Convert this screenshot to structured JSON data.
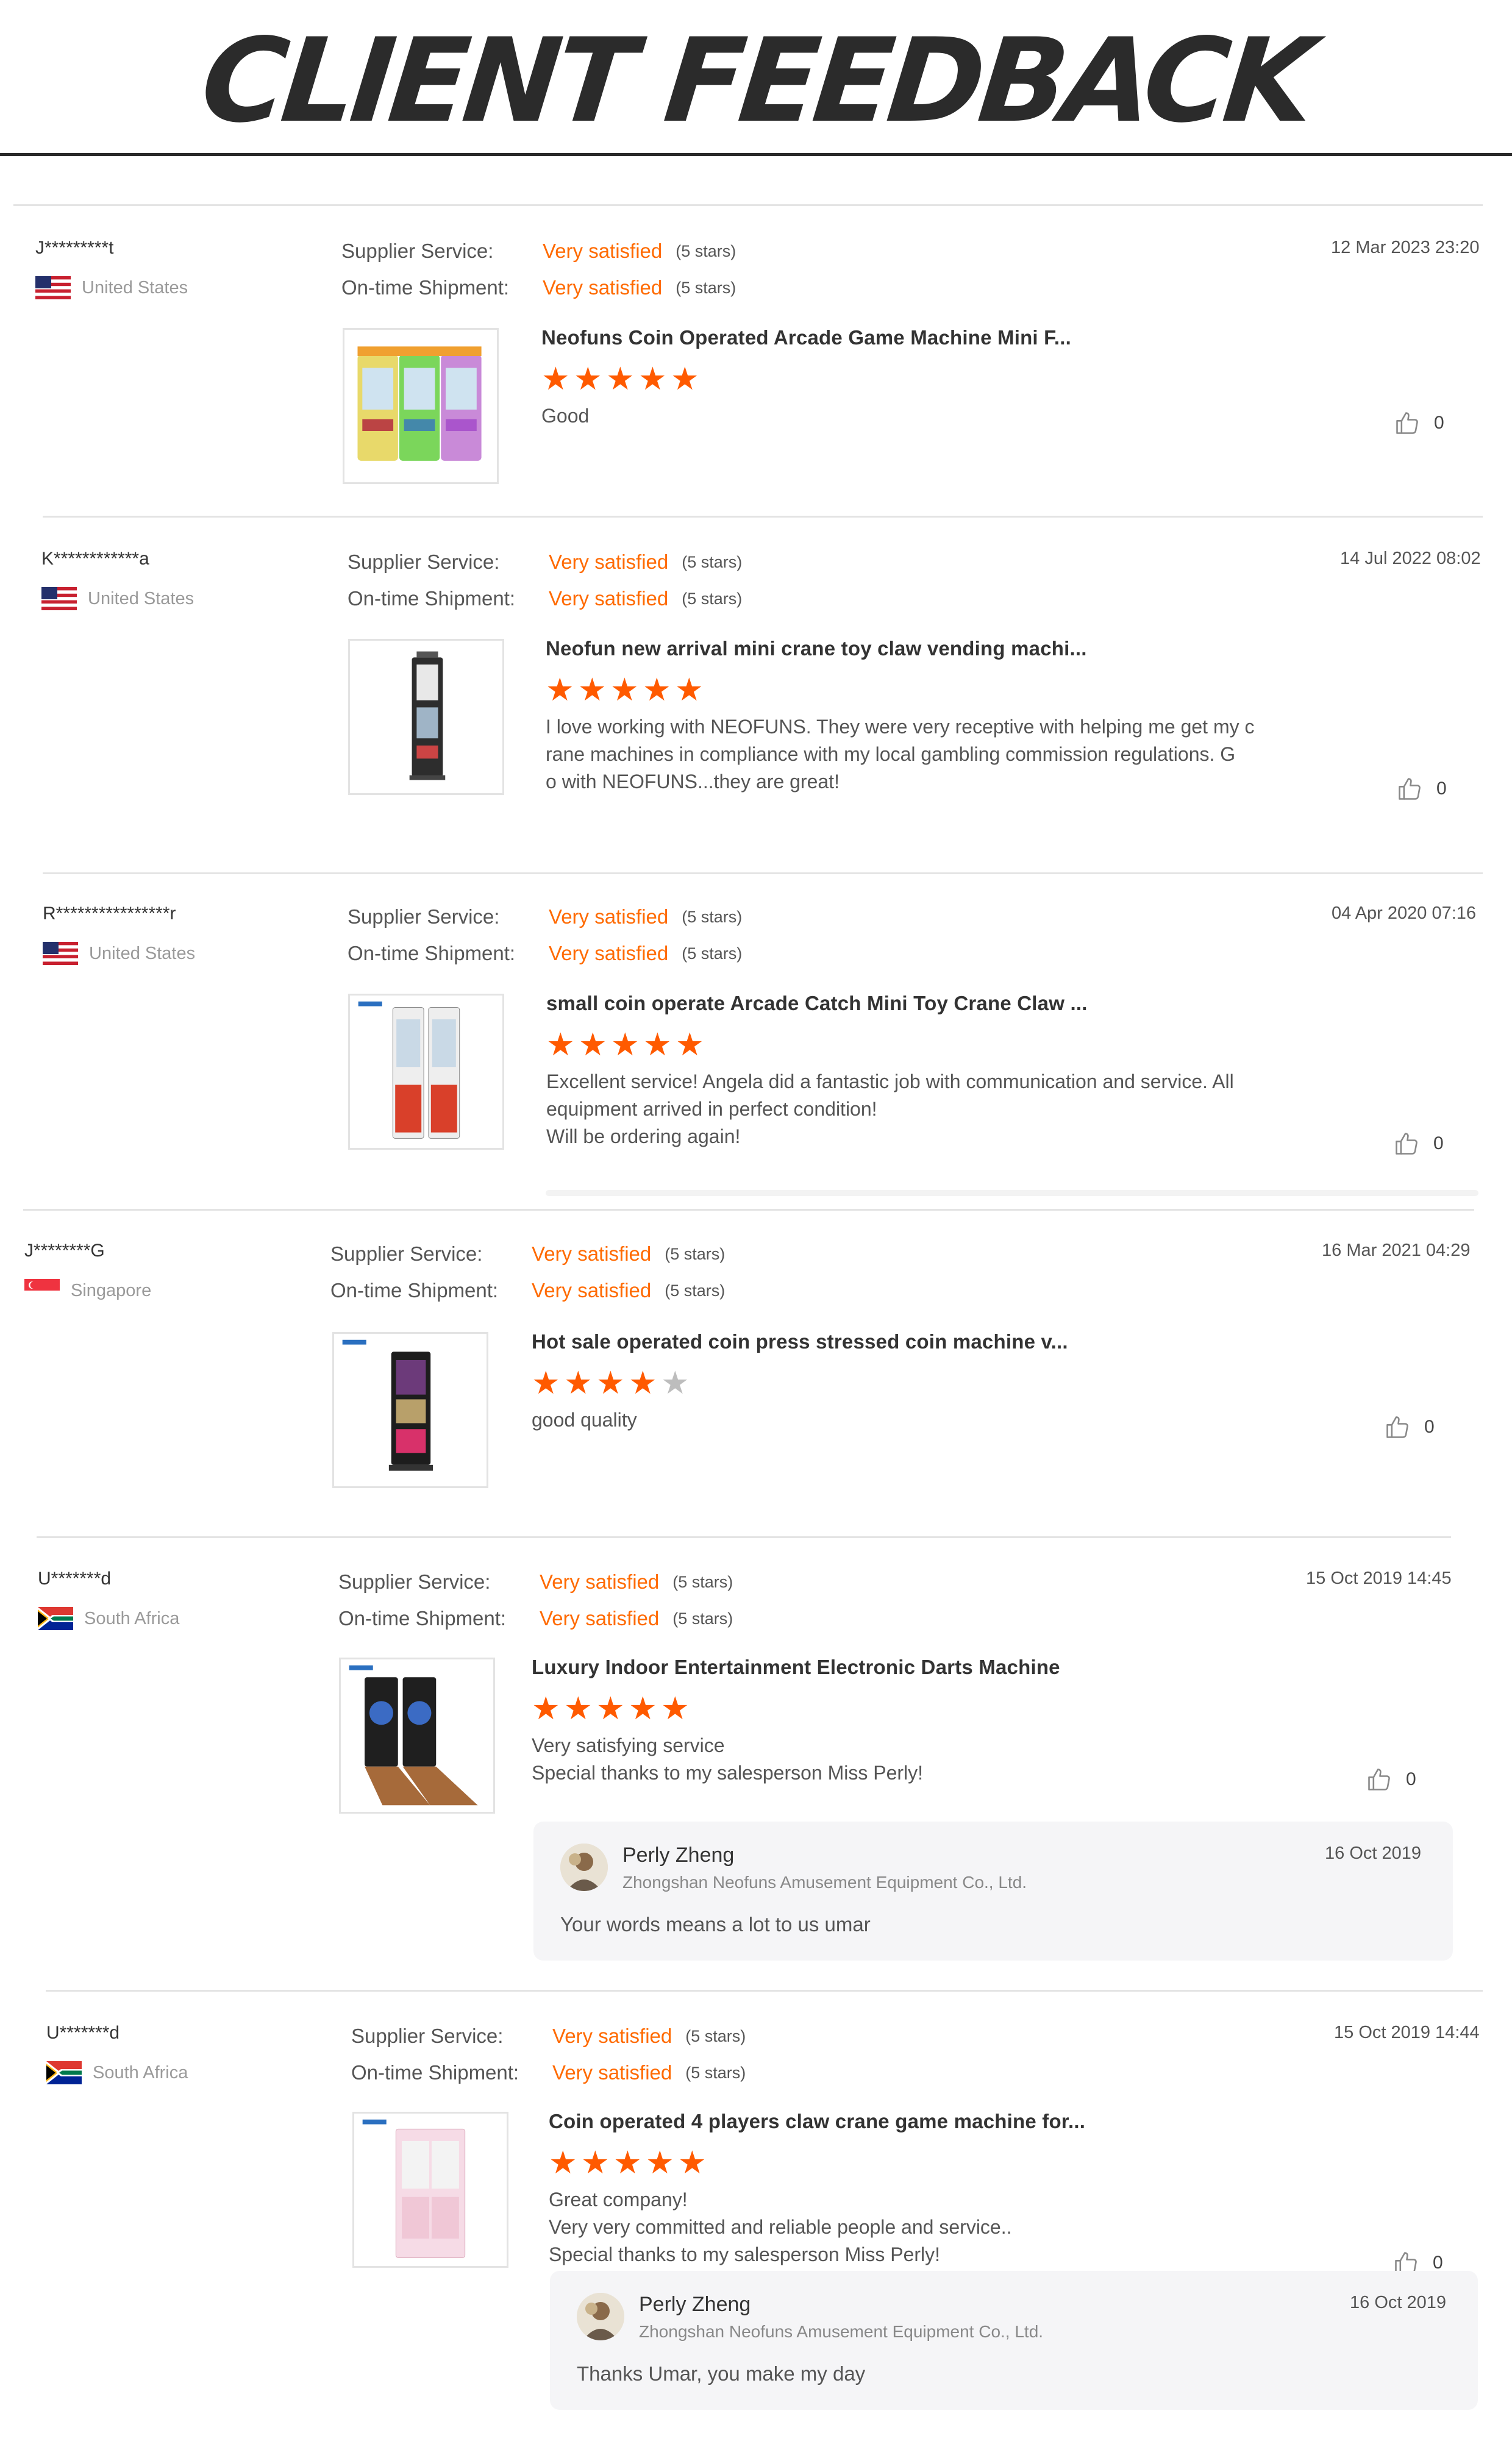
{
  "header": {
    "title": "CLIENT FEEDBACK"
  },
  "colors": {
    "accent": "#ff6a00",
    "star_filled": "#ff5a00",
    "star_empty": "#bdbdbd",
    "reply_bg": "#f5f5f7"
  },
  "labels": {
    "supplier_service": "Supplier Service:",
    "on_time_shipment": "On-time Shipment:"
  },
  "reviews": [
    {
      "buyer": "J*********t",
      "country": "United States",
      "flag": "us-flag-icon",
      "supplier_service": {
        "value": "Very satisfied",
        "stars": "(5 stars)"
      },
      "on_time_shipment": {
        "value": "Very satisfied",
        "stars": "(5 stars)"
      },
      "date": "12 Mar 2023 23:20",
      "product_title": "Neofuns Coin Operated Arcade Game Machine Mini F...",
      "rating": 5,
      "text": [
        "Good"
      ],
      "likes": "0"
    },
    {
      "buyer": "K************a",
      "country": "United States",
      "flag": "us-flag-icon",
      "supplier_service": {
        "value": "Very satisfied",
        "stars": "(5 stars)"
      },
      "on_time_shipment": {
        "value": "Very satisfied",
        "stars": "(5 stars)"
      },
      "date": "14 Jul 2022 08:02",
      "product_title": "Neofun new arrival mini crane toy claw vending machi...",
      "rating": 5,
      "text": [
        "I love working with NEOFUNS.  They were very receptive with helping me get my c",
        "rane machines in compliance with my local gambling commission regulations.  G",
        "o with NEOFUNS...they are great!"
      ],
      "likes": "0"
    },
    {
      "buyer": "R****************r",
      "country": "United States",
      "flag": "us-flag-icon",
      "supplier_service": {
        "value": "Very satisfied",
        "stars": "(5 stars)"
      },
      "on_time_shipment": {
        "value": "Very satisfied",
        "stars": "(5 stars)"
      },
      "date": "04 Apr 2020 07:16",
      "product_title": "small coin operate Arcade Catch Mini Toy Crane Claw ...",
      "rating": 5,
      "text": [
        "Excellent service!  Angela did a fantastic job with communication and service.  All",
        "equipment arrived in perfect condition!",
        "Will be ordering again!"
      ],
      "likes": "0"
    },
    {
      "buyer": "J********G",
      "country": "Singapore",
      "flag": "singapore-flag-icon",
      "supplier_service": {
        "value": "Very satisfied",
        "stars": "(5 stars)"
      },
      "on_time_shipment": {
        "value": "Very satisfied",
        "stars": "(5 stars)"
      },
      "date": "16 Mar 2021 04:29",
      "product_title": "Hot sale operated coin press stressed coin machine v...",
      "rating": 4,
      "text": [
        "good quality"
      ],
      "likes": "0"
    },
    {
      "buyer": "U*******d",
      "country": "South Africa",
      "flag": "south-africa-flag-icon",
      "supplier_service": {
        "value": "Very satisfied",
        "stars": "(5 stars)"
      },
      "on_time_shipment": {
        "value": "Very satisfied",
        "stars": "(5 stars)"
      },
      "date": "15 Oct 2019 14:45",
      "product_title": "Luxury Indoor Entertainment Electronic Darts Machine",
      "rating": 5,
      "text": [
        "Very satisfying service",
        "Special thanks to my salesperson Miss Perly!"
      ],
      "likes": "0",
      "reply": {
        "name": "Perly Zheng",
        "company": "Zhongshan Neofuns Amusement Equipment Co., Ltd.",
        "date": "16 Oct 2019",
        "text": "Your words means a lot to us umar"
      }
    },
    {
      "buyer": "U*******d",
      "country": "South Africa",
      "flag": "south-africa-flag-icon",
      "supplier_service": {
        "value": "Very satisfied",
        "stars": "(5 stars)"
      },
      "on_time_shipment": {
        "value": "Very satisfied",
        "stars": "(5 stars)"
      },
      "date": "15 Oct 2019 14:44",
      "product_title": "Coin operated 4 players claw crane game machine for...",
      "rating": 5,
      "text": [
        "Great company!",
        "Very very committed and reliable people and service..",
        "Special thanks to my salesperson Miss Perly!"
      ],
      "likes": "0",
      "reply": {
        "name": "Perly Zheng",
        "company": "Zhongshan Neofuns Amusement Equipment Co., Ltd.",
        "date": "16 Oct 2019",
        "text": "Thanks Umar, you make my day"
      }
    }
  ]
}
